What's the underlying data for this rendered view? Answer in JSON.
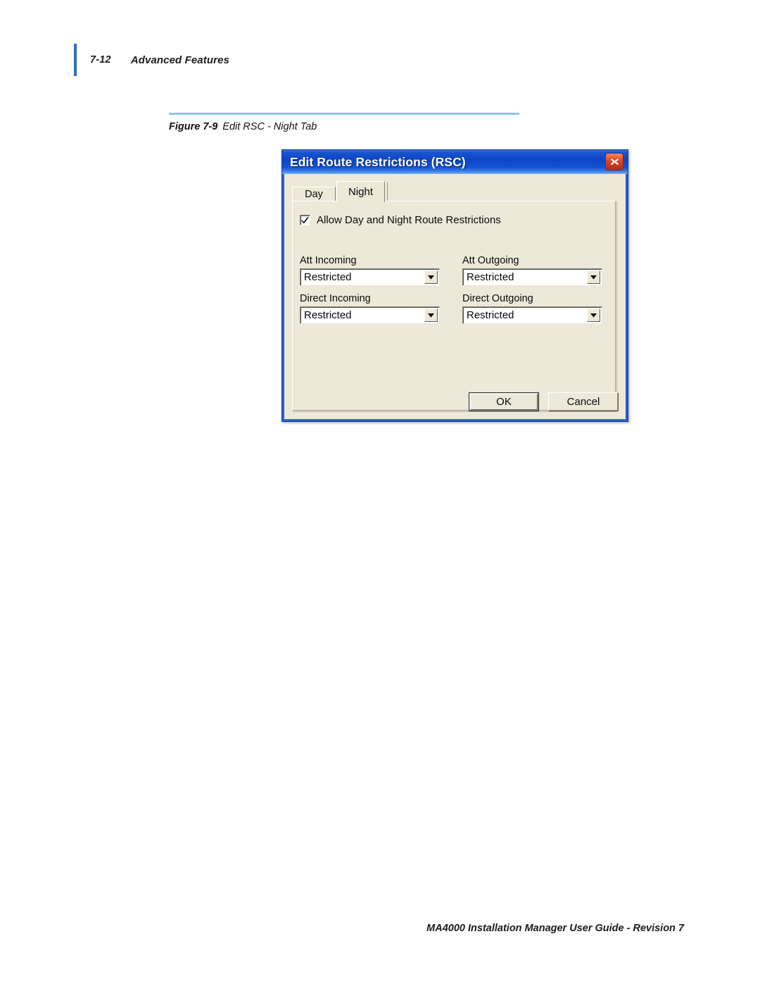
{
  "header": {
    "page_number": "7-12",
    "chapter": "Advanced Features",
    "rule_color": "#2f6fc0"
  },
  "figure": {
    "rule_color": "#94c4e4",
    "label": "Figure 7-9",
    "title": "Edit RSC - Night Tab"
  },
  "dialog": {
    "title": "Edit Route Restrictions (RSC)",
    "titlebar_color": "#0d44c4",
    "close_button": {
      "icon": "close-icon",
      "color": "#d8452a"
    },
    "tabs": [
      {
        "label": "Day",
        "active": false
      },
      {
        "label": "Night",
        "active": true
      }
    ],
    "checkbox": {
      "label": "Allow Day and Night Route Restrictions",
      "checked": true
    },
    "fields": [
      {
        "label": "Att Incoming",
        "value": "Restricted"
      },
      {
        "label": "Att Outgoing",
        "value": "Restricted"
      },
      {
        "label": "Direct Incoming",
        "value": "Restricted"
      },
      {
        "label": "Direct Outgoing",
        "value": "Restricted"
      }
    ],
    "buttons": {
      "ok": "OK",
      "cancel": "Cancel"
    }
  },
  "footer": {
    "text": "MA4000 Installation Manager User Guide - Revision 7"
  }
}
